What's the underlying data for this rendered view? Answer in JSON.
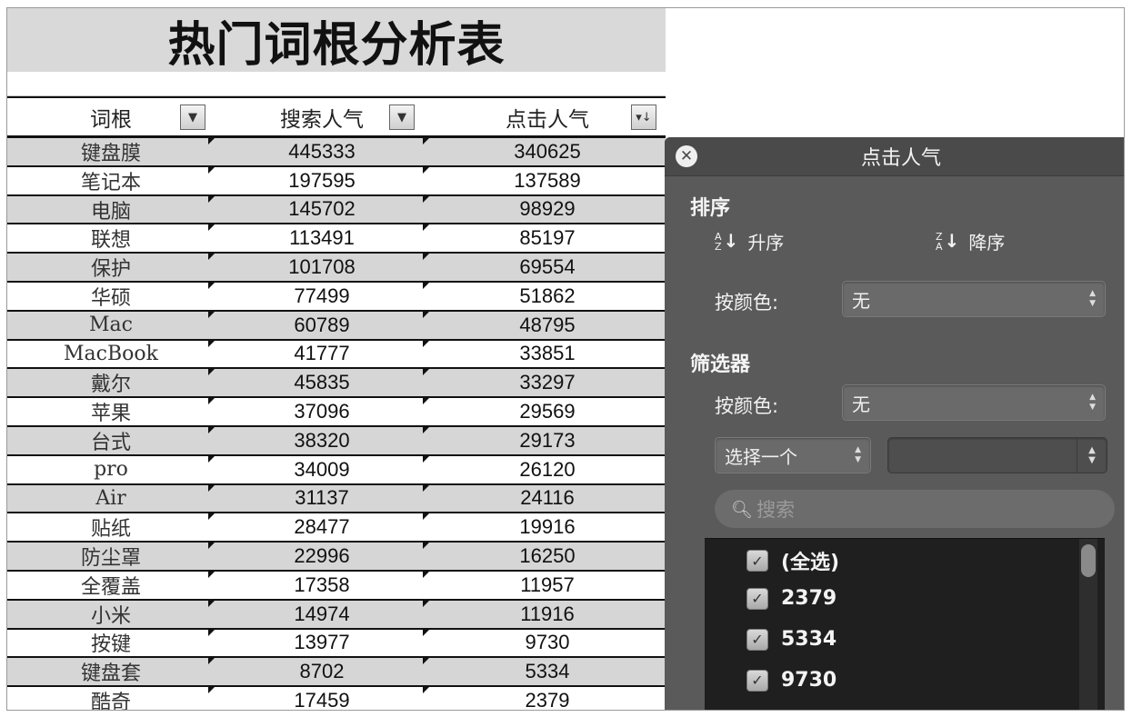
{
  "title": "热门词根分析表",
  "columns": [
    {
      "label": "词根",
      "button": "▼"
    },
    {
      "label": "搜索人气",
      "button": "▼"
    },
    {
      "label": "点击人气",
      "button": "▾↓"
    }
  ],
  "rows": [
    {
      "word": "键盘膜",
      "search": "445333",
      "click": "340625"
    },
    {
      "word": "笔记本",
      "search": "197595",
      "click": "137589"
    },
    {
      "word": "电脑",
      "search": "145702",
      "click": "98929"
    },
    {
      "word": "联想",
      "search": "113491",
      "click": "85197"
    },
    {
      "word": "保护",
      "search": "101708",
      "click": "69554"
    },
    {
      "word": "华硕",
      "search": "77499",
      "click": "51862"
    },
    {
      "word": "Mac",
      "search": "60789",
      "click": "48795"
    },
    {
      "word": "MacBook",
      "search": "41777",
      "click": "33851"
    },
    {
      "word": "戴尔",
      "search": "45835",
      "click": "33297"
    },
    {
      "word": "苹果",
      "search": "37096",
      "click": "29569"
    },
    {
      "word": "台式",
      "search": "38320",
      "click": "29173"
    },
    {
      "word": "pro",
      "search": "34009",
      "click": "26120"
    },
    {
      "word": "Air",
      "search": "31137",
      "click": "24116"
    },
    {
      "word": "贴纸",
      "search": "28477",
      "click": "19916"
    },
    {
      "word": "防尘罩",
      "search": "22996",
      "click": "16250"
    },
    {
      "word": "全覆盖",
      "search": "17358",
      "click": "11957"
    },
    {
      "word": "小米",
      "search": "14974",
      "click": "11916"
    },
    {
      "word": "按键",
      "search": "13977",
      "click": "9730"
    },
    {
      "word": "键盘套",
      "search": "8702",
      "click": "5334"
    },
    {
      "word": "酷奇",
      "search": "17459",
      "click": "2379"
    }
  ],
  "panel": {
    "title": "点击人气",
    "close": "✕",
    "sort_heading": "排序",
    "asc": "升序",
    "desc": "降序",
    "sort_color_label": "按颜色:",
    "sort_color_value": "无",
    "filter_heading": "筛选器",
    "filter_color_label": "按颜色:",
    "filter_color_value": "无",
    "choose": "选择一个",
    "choose_value": "",
    "search_placeholder": "搜索",
    "list": [
      {
        "label": "(全选)",
        "checked": true
      },
      {
        "label": "2379",
        "checked": true
      },
      {
        "label": "5334",
        "checked": true
      },
      {
        "label": "9730",
        "checked": true
      }
    ]
  }
}
